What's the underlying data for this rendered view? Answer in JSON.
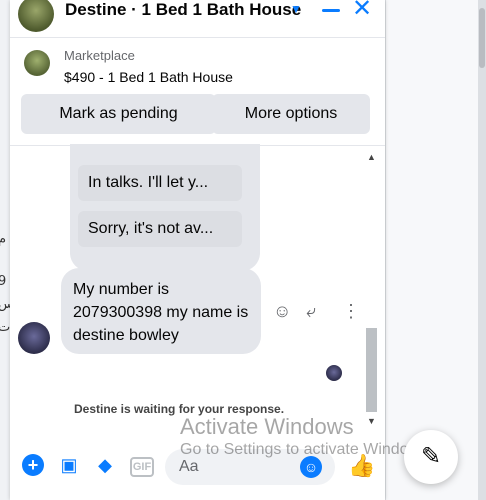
{
  "header": {
    "title": "Destine · 1 Bed 1 Bath House",
    "chevron_icon": "chevron-down-icon",
    "minimize_icon": "minus-icon",
    "close_icon": "close-icon",
    "color": "#0a7cff"
  },
  "marketplace": {
    "label": "Marketplace",
    "listing": "$490 - 1 Bed 1 Bath House",
    "buttons": {
      "pending": "Mark as pending",
      "more": "More options"
    }
  },
  "messages": {
    "quick_replies": [
      "In talks. I'll let y...",
      "Sorry, it's not av..."
    ],
    "incoming": "My number is 2079300398 my name is destine bowley",
    "waiting": "Destine is waiting for your response."
  },
  "composer": {
    "placeholder": "Aa",
    "gif_label": "GIF"
  },
  "watermark": {
    "line1": "Activate Windows",
    "line2": "Go to Settings to activate Windows."
  },
  "background": {
    "fragments": [
      "م",
      "9",
      "س",
      "ت"
    ]
  }
}
